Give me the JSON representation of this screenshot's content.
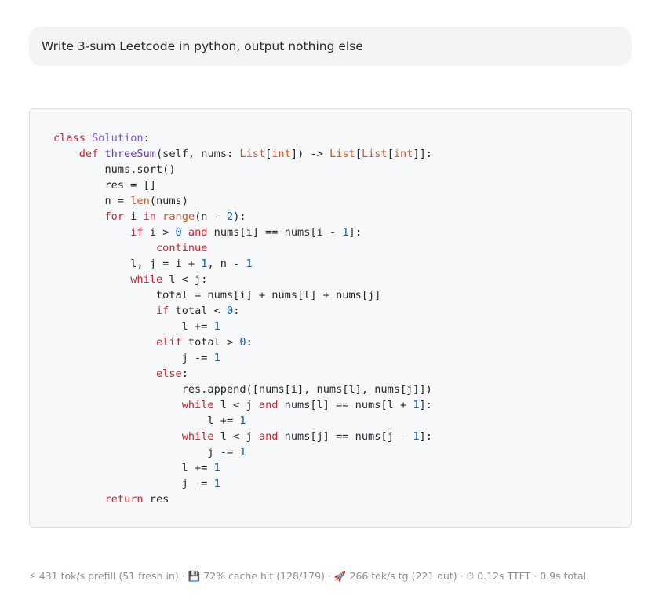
{
  "prompt": {
    "text": "Write 3-sum Leetcode in python, output nothing else"
  },
  "code": {
    "lines": [
      [
        [
          "kw",
          "class"
        ],
        [
          "id",
          " "
        ],
        [
          "cls",
          "Solution"
        ],
        [
          "op",
          ":"
        ]
      ],
      [
        [
          "id",
          "    "
        ],
        [
          "kw",
          "def"
        ],
        [
          "id",
          " "
        ],
        [
          "fn",
          "threeSum"
        ],
        [
          "op",
          "("
        ],
        [
          "id",
          "self, nums: "
        ],
        [
          "bi",
          "List"
        ],
        [
          "op",
          "["
        ],
        [
          "bi",
          "int"
        ],
        [
          "op",
          "]) -> "
        ],
        [
          "bi",
          "List"
        ],
        [
          "op",
          "["
        ],
        [
          "bi",
          "List"
        ],
        [
          "op",
          "["
        ],
        [
          "bi",
          "int"
        ],
        [
          "op",
          "]]:"
        ]
      ],
      [
        [
          "id",
          "        nums.sort()"
        ]
      ],
      [
        [
          "id",
          "        res = []"
        ]
      ],
      [
        [
          "id",
          "        n = "
        ],
        [
          "bi",
          "len"
        ],
        [
          "op",
          "(nums)"
        ]
      ],
      [
        [
          "id",
          "        "
        ],
        [
          "kw",
          "for"
        ],
        [
          "id",
          " i "
        ],
        [
          "kw",
          "in"
        ],
        [
          "id",
          " "
        ],
        [
          "bi",
          "range"
        ],
        [
          "op",
          "(n - "
        ],
        [
          "num",
          "2"
        ],
        [
          "op",
          "):"
        ]
      ],
      [
        [
          "id",
          "            "
        ],
        [
          "kw",
          "if"
        ],
        [
          "id",
          " i > "
        ],
        [
          "num",
          "0"
        ],
        [
          "id",
          " "
        ],
        [
          "kw",
          "and"
        ],
        [
          "id",
          " nums[i] == nums[i - "
        ],
        [
          "num",
          "1"
        ],
        [
          "op",
          "]:"
        ]
      ],
      [
        [
          "id",
          "                "
        ],
        [
          "kw",
          "continue"
        ]
      ],
      [
        [
          "id",
          "            l, j = i + "
        ],
        [
          "num",
          "1"
        ],
        [
          "op",
          ", n - "
        ],
        [
          "num",
          "1"
        ]
      ],
      [
        [
          "id",
          "            "
        ],
        [
          "kw",
          "while"
        ],
        [
          "id",
          " l < j:"
        ]
      ],
      [
        [
          "id",
          "                total = nums[i] + nums[l] + nums[j]"
        ]
      ],
      [
        [
          "id",
          "                "
        ],
        [
          "kw",
          "if"
        ],
        [
          "id",
          " total < "
        ],
        [
          "num",
          "0"
        ],
        [
          "op",
          ":"
        ]
      ],
      [
        [
          "id",
          "                    l += "
        ],
        [
          "num",
          "1"
        ]
      ],
      [
        [
          "id",
          "                "
        ],
        [
          "kw",
          "elif"
        ],
        [
          "id",
          " total > "
        ],
        [
          "num",
          "0"
        ],
        [
          "op",
          ":"
        ]
      ],
      [
        [
          "id",
          "                    j -= "
        ],
        [
          "num",
          "1"
        ]
      ],
      [
        [
          "id",
          "                "
        ],
        [
          "kw",
          "else"
        ],
        [
          "op",
          ":"
        ]
      ],
      [
        [
          "id",
          "                    res.append([nums[i], nums[l], nums[j]])"
        ]
      ],
      [
        [
          "id",
          "                    "
        ],
        [
          "kw",
          "while"
        ],
        [
          "id",
          " l < j "
        ],
        [
          "kw",
          "and"
        ],
        [
          "id",
          " nums[l] == nums[l + "
        ],
        [
          "num",
          "1"
        ],
        [
          "op",
          "]:"
        ]
      ],
      [
        [
          "id",
          "                        l += "
        ],
        [
          "num",
          "1"
        ]
      ],
      [
        [
          "id",
          "                    "
        ],
        [
          "kw",
          "while"
        ],
        [
          "id",
          " l < j "
        ],
        [
          "kw",
          "and"
        ],
        [
          "id",
          " nums[j] == nums[j - "
        ],
        [
          "num",
          "1"
        ],
        [
          "op",
          "]:"
        ]
      ],
      [
        [
          "id",
          "                        j -= "
        ],
        [
          "num",
          "1"
        ]
      ],
      [
        [
          "id",
          "                    l += "
        ],
        [
          "num",
          "1"
        ]
      ],
      [
        [
          "id",
          "                    j -= "
        ],
        [
          "num",
          "1"
        ]
      ],
      [
        [
          "id",
          "        "
        ],
        [
          "kw",
          "return"
        ],
        [
          "id",
          " res"
        ]
      ]
    ]
  },
  "stats": {
    "prefill_icon": "⚡",
    "prefill": "431 tok/s prefill (51 fresh in)",
    "sep1": " · ",
    "cache_icon": "💾",
    "cache": "72% cache hit (128/179)",
    "sep2": " · ",
    "tg_icon": "🚀",
    "tg": "266 tok/s tg (221 out)",
    "sep3": " · ",
    "ttft_icon": "⏱",
    "ttft": "0.12s TTFT",
    "sep4": " · ",
    "total": "0.9s total"
  }
}
